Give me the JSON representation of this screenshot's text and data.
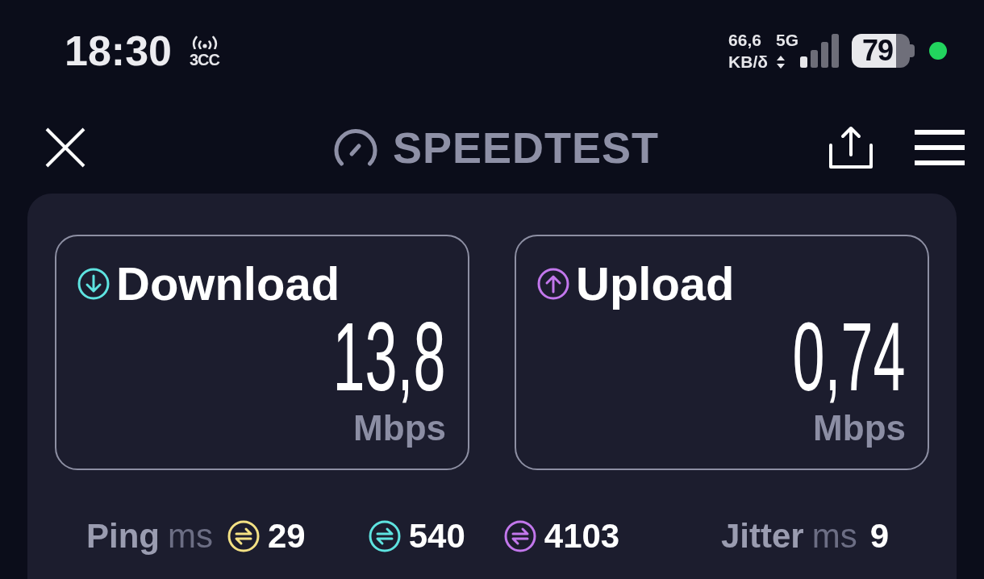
{
  "status_bar": {
    "time": "18:30",
    "network_label": "3CC",
    "speed_value": "66,6",
    "speed_unit": "KB/δ",
    "network_type": "5G",
    "battery": "79"
  },
  "header": {
    "title": "SPEEDTEST"
  },
  "results": [
    {
      "kind": "download",
      "label": "Download",
      "value": "13,8",
      "unit": "Mbps",
      "color": "#5ee3e0"
    },
    {
      "kind": "upload",
      "label": "Upload",
      "value": "0,74",
      "unit": "Mbps",
      "color": "#c277ec"
    }
  ],
  "ping": {
    "label": "Ping",
    "unit": "ms",
    "readings": [
      {
        "value": "29",
        "color": "#f3e184"
      },
      {
        "value": "540",
        "color": "#5ee3e0"
      },
      {
        "value": "4103",
        "color": "#c277ec"
      }
    ]
  },
  "jitter": {
    "label": "Jitter",
    "unit": "ms",
    "value": "9"
  }
}
